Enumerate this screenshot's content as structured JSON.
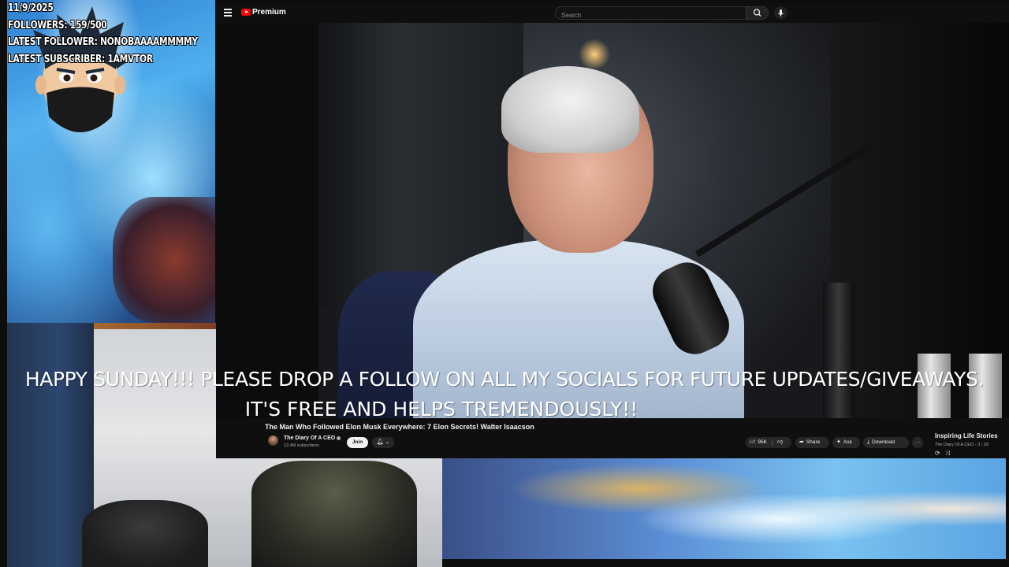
{
  "stream": {
    "date": "11/9/2025",
    "followers": "FOLLOWERS: 159/500",
    "latest_follower": "LATEST FOLLOWER: NONOBAAAAMMMMY",
    "latest_subscriber": "LATEST SUBSCRIBER: 1AMVTOR"
  },
  "banner": {
    "line1": "HAPPY SUNDAY!!! PLEASE DROP A FOLLOW ON ALL MY SOCIALS FOR FUTURE UPDATES/GIVEAWAYS.",
    "line2": "IT'S FREE AND HELPS TREMENDOUSLY!!"
  },
  "youtube": {
    "brand": "Premium",
    "search_placeholder": "Search",
    "video": {
      "title": "The Man Who Followed Elon Musk Everywhere: 7 Elon Secrets! Walter Isaacson",
      "channel": "The Diary Of A CEO",
      "subscribers": "13.4M subscribers",
      "join_label": "Join",
      "likes": "95K",
      "share_label": "Share",
      "ask_label": "Ask",
      "download_label": "Download",
      "more_label": "···"
    },
    "playlist": {
      "title": "Inspiring Life Stories",
      "subtitle": "The Diary Of A CEO - 3 / 29"
    }
  },
  "colors": {
    "youtube_red": "#ff0000",
    "yt_background": "#0f0f0f",
    "pill_background": "#272727"
  }
}
